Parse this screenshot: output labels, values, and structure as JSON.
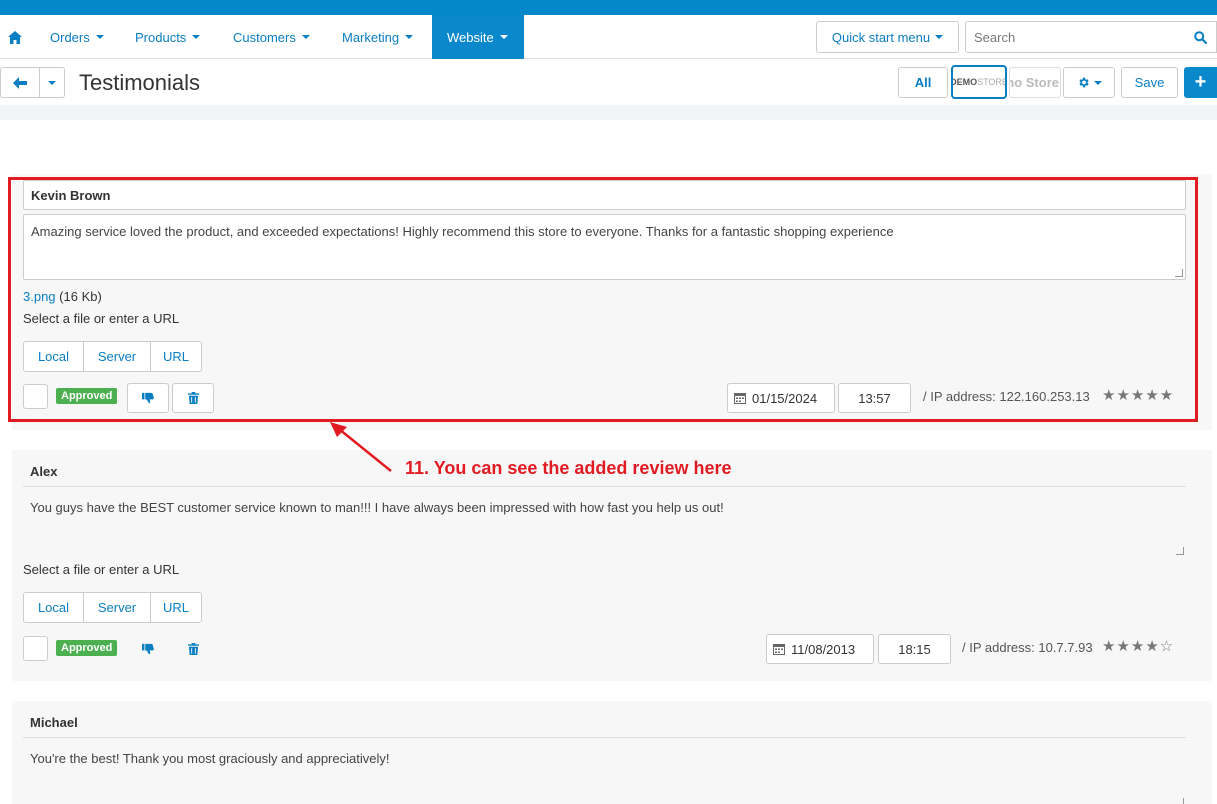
{
  "nav": {
    "items": [
      {
        "label": "Orders"
      },
      {
        "label": "Products"
      },
      {
        "label": "Customers"
      },
      {
        "label": "Marketing"
      },
      {
        "label": "Website"
      }
    ],
    "quick_start": "Quick start menu",
    "search_placeholder": "Search"
  },
  "actionbar": {
    "title": "Testimonials",
    "all_label": "All",
    "store1_bold": "DEMO",
    "store1_light": "STORE",
    "store2_label": "Demo Store",
    "save_label": "Save",
    "add_label": "+"
  },
  "reviews": [
    {
      "name": "Kevin Brown",
      "message": "Amazing service loved the product, and exceeded expectations! Highly recommend this store to everyone. Thanks for a fantastic shopping experience",
      "file_name": "3.png",
      "file_size": "(16 Kb)",
      "select_text": "Select a file or enter a URL",
      "sources": [
        "Local",
        "Server",
        "URL"
      ],
      "status": "Approved",
      "date": "01/15/2024",
      "time": "13:57",
      "ip": "/ IP address: 122.160.253.13",
      "stars": "★★★★★",
      "rating": 5
    },
    {
      "name": "Alex",
      "message": "You guys have the BEST customer service known to man!!! I have always been impressed with how fast you help us out!",
      "select_text": "Select a file or enter a URL",
      "sources": [
        "Local",
        "Server",
        "URL"
      ],
      "status": "Approved",
      "date": "11/08/2013",
      "time": "18:15",
      "ip": "/ IP address: 10.7.7.93",
      "stars": "★★★★☆",
      "rating": 4
    },
    {
      "name": "Michael",
      "message": "You're the best! Thank you most graciously and appreciatively!"
    }
  ],
  "annotation": "11. You can see the added review here",
  "colors": {
    "brand_blue": "#0a88cc",
    "link_blue": "#0a7ec2",
    "approved_green": "#4caf50",
    "annotation_red": "#e21b23"
  }
}
